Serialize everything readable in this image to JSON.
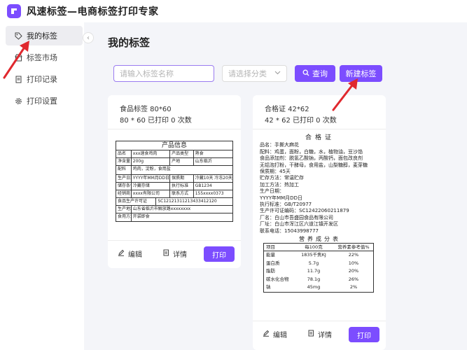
{
  "app": {
    "title": "风速标签—电商标签打印专家"
  },
  "sidebar": {
    "items": [
      {
        "label": "我的标签",
        "icon": "tag-icon",
        "active": true
      },
      {
        "label": "标签市场",
        "icon": "store-icon",
        "active": false
      },
      {
        "label": "打印记录",
        "icon": "document-icon",
        "active": false
      },
      {
        "label": "打印设置",
        "icon": "gear-icon",
        "active": false
      }
    ],
    "collapse_icon": "‹"
  },
  "page": {
    "title": "我的标签"
  },
  "toolbar": {
    "search_placeholder": "请输入标签名称",
    "category_placeholder": "请选择分类",
    "search_button": "查询",
    "new_button": "新建标签"
  },
  "cards": [
    {
      "name": "食品标签 80*60",
      "meta": "80 * 60  已打印 0 次数",
      "actions": {
        "edit": "编辑",
        "detail": "详情",
        "print": "打印"
      },
      "preview": {
        "title": "产品信息",
        "rows": [
          [
            "品名",
            "xxx速食鸡肉",
            "产品类型",
            "熟食"
          ],
          [
            "净含量",
            "200g",
            "产地",
            "山东临沂"
          ],
          [
            "配料",
            "鸡肉，淀粉，食用盐"
          ],
          [
            "生产日期",
            "YYYY年MM月DD日",
            "保质期",
            "冷藏10天 冷冻20天"
          ],
          [
            "储存条件",
            "冷藏存储",
            "执行标准",
            "GB1234"
          ],
          [
            "经销商",
            "xxxx有限公司",
            "联系方式",
            "155xxxx0373"
          ],
          [
            "食品生产许可证",
            "SC12121311213433412120"
          ],
          [
            "生产地址",
            "山东省临沂市解放路xxxxxxxx"
          ],
          [
            "食用方法",
            "开袋即食"
          ]
        ]
      }
    },
    {
      "name": "合格证 42*62",
      "meta": "42 * 62  已打印 0 次数",
      "actions": {
        "edit": "编辑",
        "detail": "详情",
        "print": "打印"
      },
      "preview": {
        "title": "合格证",
        "lines": [
          "品名：手撕大麻花",
          "配料：鸡蛋，面粉，白糖，水，植物油，豆沙馅",
          "食品添加剂：脱氢乙酸钠，丙酸钙，面包改良剂",
          "无铝泡打粉，干酵母，食用盐，山梨糖醇，麦芽糖",
          "保质期：45天",
          "贮存方法：常温贮存",
          "加工方法：热加工",
          "生产日期：",
          "YYYY年MM月DD日",
          "执行标准：GB/T20977",
          "生产许可证编码：SC12422060211879",
          "厂名：白山市吾盛园食品有限公司",
          "厂址：白山市浑江区六道江镇开发区",
          "联系电话：15043998777"
        ],
        "nutrition_title": "营养成分表",
        "nutrition_header": [
          "项目",
          "每100克",
          "营养素参考值%"
        ],
        "nutrition_rows": [
          [
            "能量",
            "1835千焦KJ",
            "22%"
          ],
          [
            "蛋白质",
            "5.7g",
            "10%"
          ],
          [
            "脂肪",
            "11.7g",
            "20%"
          ],
          [
            "碳水化合物",
            "78.1g",
            "26%"
          ],
          [
            "钠",
            "45mg",
            "2%"
          ]
        ]
      }
    }
  ],
  "annotation_color": "#e0282e"
}
